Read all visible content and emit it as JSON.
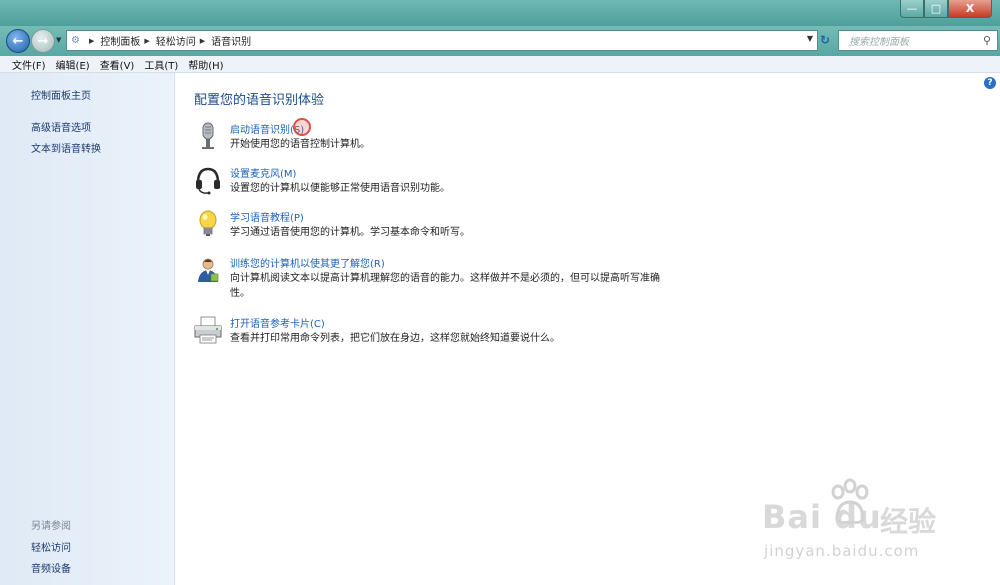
{
  "window": {
    "minimize": "—",
    "maximize": "□",
    "close": "X"
  },
  "nav": {
    "breadcrumb": [
      "控制面板",
      "轻松访问",
      "语音识别"
    ],
    "search_placeholder": "搜索控制面板"
  },
  "menu": [
    "文件(F)",
    "编辑(E)",
    "查看(V)",
    "工具(T)",
    "帮助(H)"
  ],
  "sidebar": {
    "home": "控制面板主页",
    "links": [
      "高级语音选项",
      "文本到语音转换"
    ],
    "see_also_heading": "另请参阅",
    "see_also": [
      "轻松访问",
      "音频设备"
    ]
  },
  "main": {
    "title": "配置您的语音识别体验",
    "help": "?",
    "tasks": [
      {
        "icon": "microphone-icon",
        "link": "启动语音识别(S)",
        "desc": "开始使用您的语音控制计算机。"
      },
      {
        "icon": "headset-icon",
        "link": "设置麦克风(M)",
        "desc": "设置您的计算机以便能够正常使用语音识别功能。"
      },
      {
        "icon": "lightbulb-icon",
        "link": "学习语音教程(P)",
        "desc": "学习通过语音使用您的计算机。学习基本命令和听写。"
      },
      {
        "icon": "person-icon",
        "link": "训练您的计算机以使其更了解您(R)",
        "desc": "向计算机阅读文本以提高计算机理解您的语音的能力。这样做并不是必须的，但可以提高听写准确性。"
      },
      {
        "icon": "printer-icon",
        "link": "打开语音参考卡片(C)",
        "desc": "查看并打印常用命令列表，把它们放在身边，这样您就始终知道要说什么。"
      }
    ]
  },
  "watermark": {
    "brand": "Bai du",
    "brand_cn": "经验",
    "url": "jingyan.baidu.com"
  }
}
